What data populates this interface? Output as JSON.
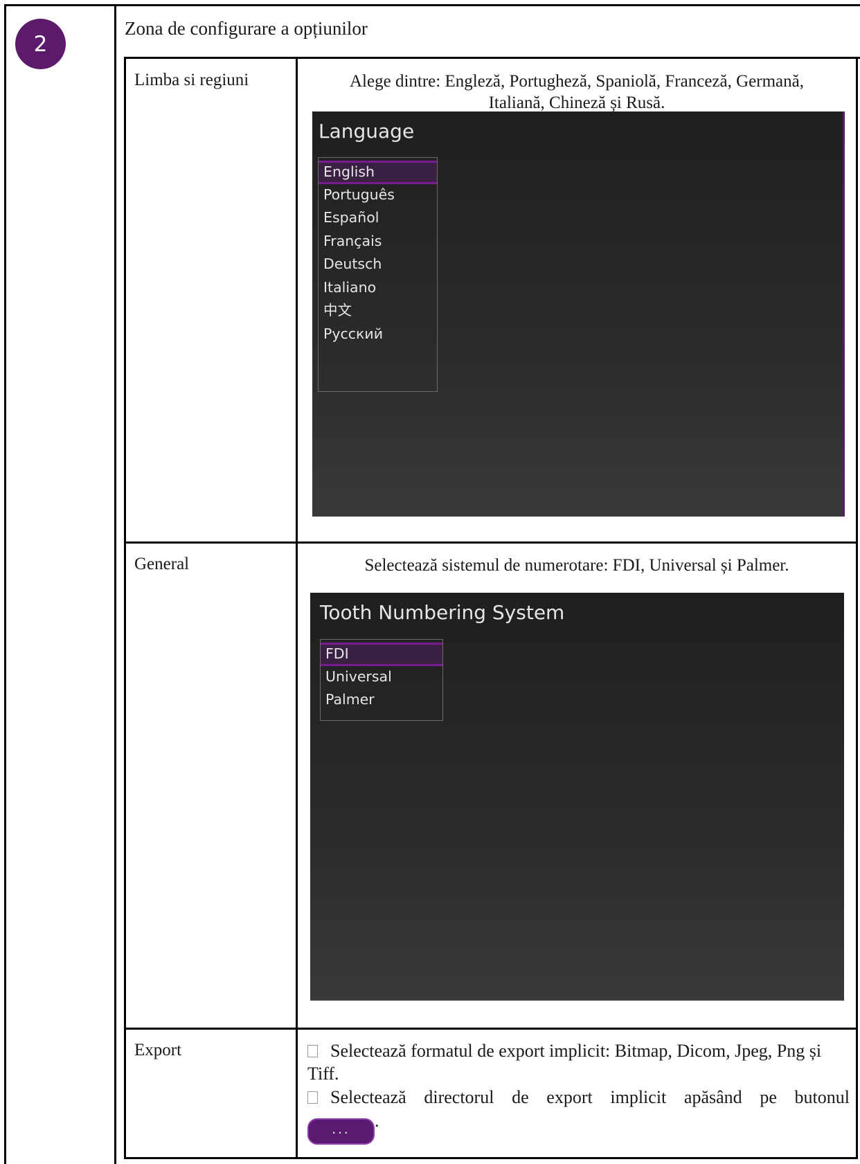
{
  "badge_number": "2",
  "section_title": "Zona de configurare a opțiunilor",
  "rows": {
    "language": {
      "label": "Limba si regiuni",
      "description_line1": "Alege dintre: Engleză, Portugheză, Spaniolă, Franceză, Germană,",
      "description_line2": "Italiană, Chineză și Rusă.",
      "panel_title": "Language",
      "items": [
        "English",
        "Português",
        "Español",
        "Français",
        "Deutsch",
        "Italiano",
        "中文",
        "Русский"
      ]
    },
    "general": {
      "label": "General",
      "description": "Selectează sistemul de numerotare: FDI, Universal și Palmer.",
      "panel_title": "Tooth Numbering System",
      "items": [
        "FDI",
        "Universal",
        "Palmer"
      ]
    },
    "export": {
      "label": "Export",
      "bullet1": "Selectează formatul de export implicit: Bitmap, Dicom, Jpeg, Png și Tiff.",
      "bullet2": "Selectează directorul de export implicit apăsând pe butonul",
      "button_label": "...",
      "trailing": "."
    }
  },
  "colors": {
    "accent_purple": "#5c1a6b",
    "selection_border": "#7b1c92",
    "panel_bg": "#2a2a2a"
  }
}
